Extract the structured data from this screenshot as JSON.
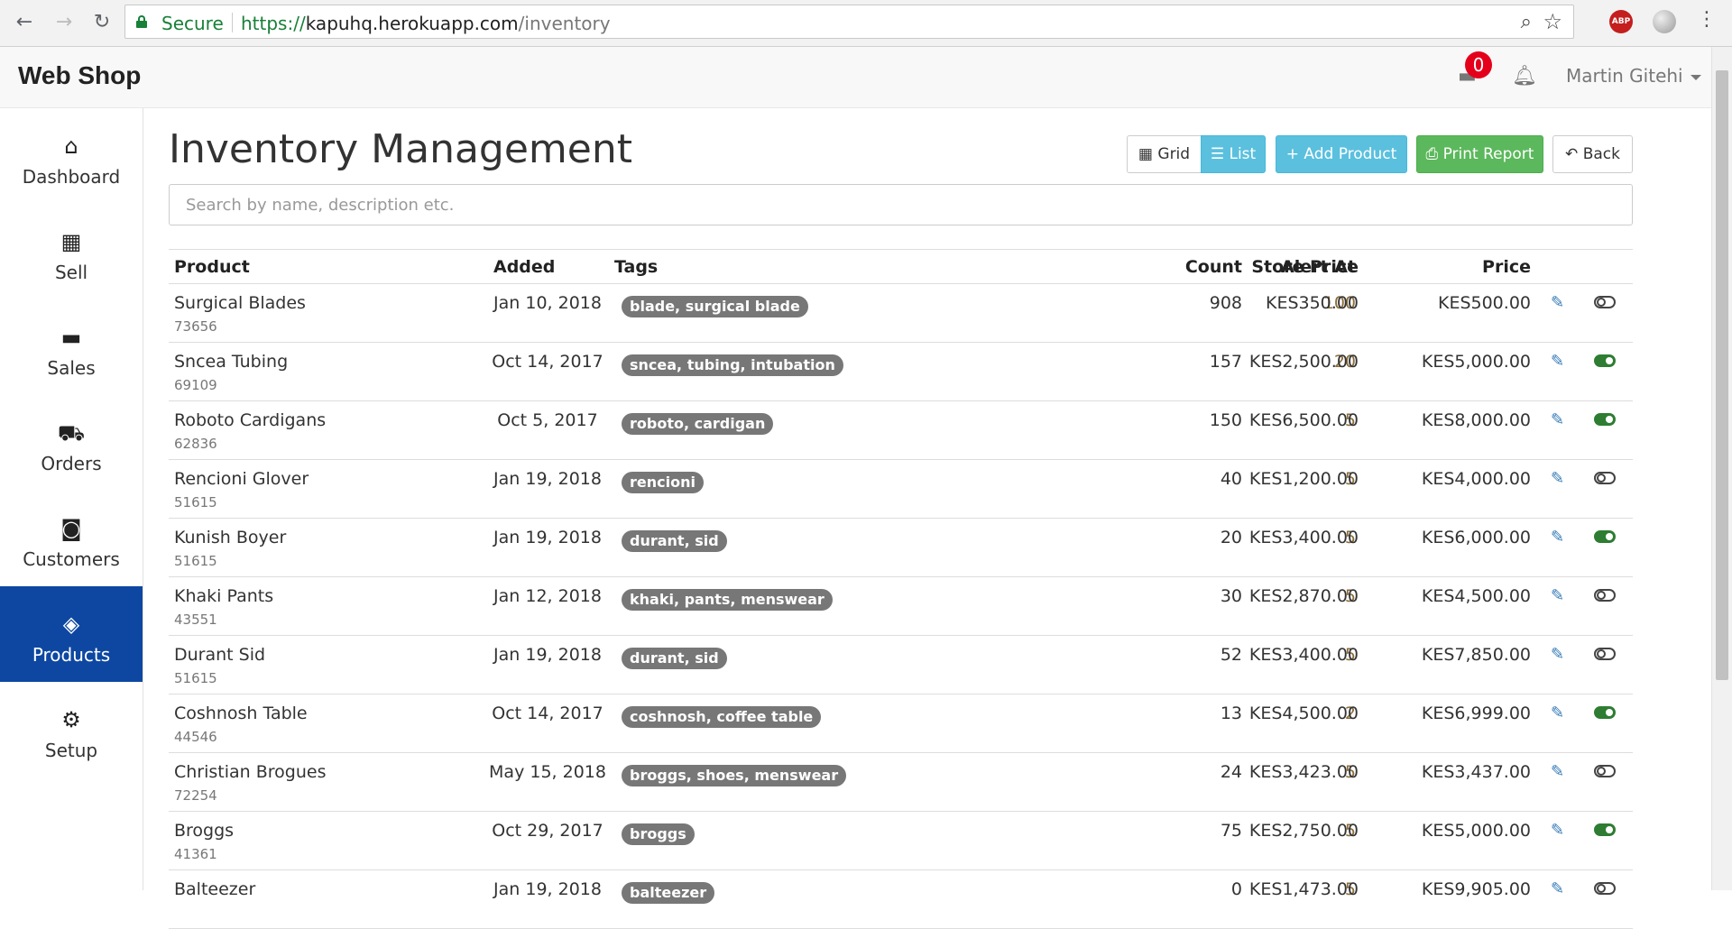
{
  "browser": {
    "secure_label": "Secure",
    "url_scheme": "https://",
    "url_host": "kapuhq.herokuapp.com",
    "url_path": "/inventory",
    "extension_abp": "ABP"
  },
  "header": {
    "brand": "Web Shop",
    "cart_count": "0",
    "user_name": "Martin Gitehi"
  },
  "sidebar": {
    "items": [
      {
        "label": "Dashboard",
        "icon": "home-icon",
        "glyph": "⌂"
      },
      {
        "label": "Sell",
        "icon": "calculator-icon",
        "glyph": "▦"
      },
      {
        "label": "Sales",
        "icon": "credit-card-icon",
        "glyph": "▬"
      },
      {
        "label": "Orders",
        "icon": "truck-icon",
        "glyph": "⛟"
      },
      {
        "label": "Customers",
        "icon": "address-book-icon",
        "glyph": "◙"
      },
      {
        "label": "Products",
        "icon": "tags-icon",
        "glyph": "◈"
      },
      {
        "label": "Setup",
        "icon": "gears-icon",
        "glyph": "⚙"
      }
    ],
    "active": "Products"
  },
  "page": {
    "title": "Inventory Management",
    "search_placeholder": "Search by name, description etc."
  },
  "toolbar": {
    "grid_label": "Grid",
    "list_label": "List",
    "add_label": "Add Product",
    "print_label": "Print Report",
    "back_label": "Back"
  },
  "table": {
    "headers": {
      "product": "Product",
      "added": "Added",
      "tags": "Tags",
      "count": "Count",
      "alert": "Alert At",
      "store_price": "Store Price",
      "price": "Price"
    },
    "rows": [
      {
        "name": "Surgical Blades",
        "sku": "73656",
        "added": "Jan 10, 2018",
        "tags": "blade, surgical blade",
        "count": "908",
        "alert": "100",
        "store_price": "KES350.00",
        "price": "KES500.00",
        "active": false
      },
      {
        "name": "Sncea Tubing",
        "sku": "69109",
        "added": "Oct 14, 2017",
        "tags": "sncea, tubing, intubation",
        "count": "157",
        "alert": "20",
        "store_price": "KES2,500.00",
        "price": "KES5,000.00",
        "active": true
      },
      {
        "name": "Roboto Cardigans",
        "sku": "62836",
        "added": "Oct 5, 2017",
        "tags": "roboto, cardigan",
        "count": "150",
        "alert": "5",
        "store_price": "KES6,500.00",
        "price": "KES8,000.00",
        "active": true
      },
      {
        "name": "Rencioni Glover",
        "sku": "51615",
        "added": "Jan 19, 2018",
        "tags": "rencioni",
        "count": "40",
        "alert": "5",
        "store_price": "KES1,200.00",
        "price": "KES4,000.00",
        "active": false
      },
      {
        "name": "Kunish Boyer",
        "sku": "51615",
        "added": "Jan 19, 2018",
        "tags": "durant, sid",
        "count": "20",
        "alert": "5",
        "store_price": "KES3,400.00",
        "price": "KES6,000.00",
        "active": true
      },
      {
        "name": "Khaki Pants",
        "sku": "43551",
        "added": "Jan 12, 2018",
        "tags": "khaki, pants, menswear",
        "count": "30",
        "alert": "5",
        "store_price": "KES2,870.00",
        "price": "KES4,500.00",
        "active": false
      },
      {
        "name": "Durant Sid",
        "sku": "51615",
        "added": "Jan 19, 2018",
        "tags": "durant, sid",
        "count": "52",
        "alert": "5",
        "store_price": "KES3,400.00",
        "price": "KES7,850.00",
        "active": false
      },
      {
        "name": "Coshnosh Table",
        "sku": "44546",
        "added": "Oct 14, 2017",
        "tags": "coshnosh, coffee table",
        "count": "13",
        "alert": "2",
        "store_price": "KES4,500.00",
        "price": "KES6,999.00",
        "active": true
      },
      {
        "name": "Christian Brogues",
        "sku": "72254",
        "added": "May 15, 2018",
        "tags": "broggs, shoes, menswear",
        "count": "24",
        "alert": "5",
        "store_price": "KES3,423.00",
        "price": "KES3,437.00",
        "active": false
      },
      {
        "name": "Broggs",
        "sku": "41361",
        "added": "Oct 29, 2017",
        "tags": "broggs",
        "count": "75",
        "alert": "5",
        "store_price": "KES2,750.00",
        "price": "KES5,000.00",
        "active": true
      },
      {
        "name": "Balteezer",
        "sku": "",
        "added": "Jan 19, 2018",
        "tags": "balteezer",
        "count": "0",
        "alert": "5",
        "store_price": "KES1,473.00",
        "price": "KES9,905.00",
        "active": false
      }
    ]
  }
}
